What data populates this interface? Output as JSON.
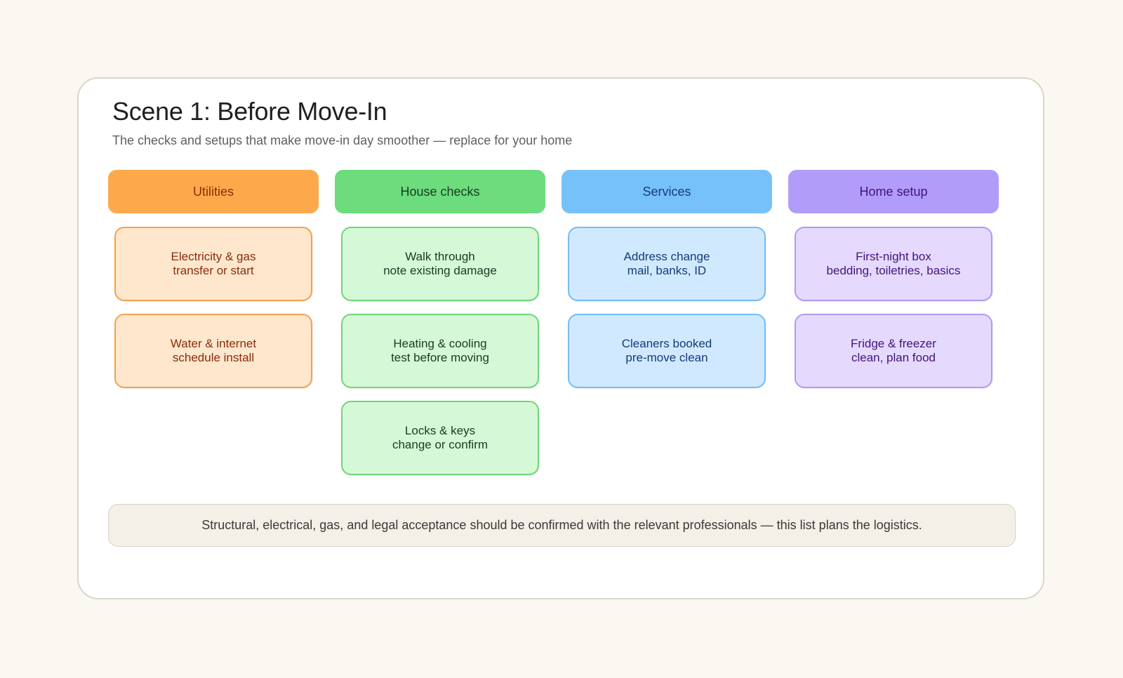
{
  "title": "Scene 1: Before Move-In",
  "subtitle": "The checks and setups that make move-in day smoother — replace for your home",
  "columns": [
    {
      "header": "Utilities",
      "colors": {
        "header_bg": "#fda94b",
        "header_text": "#8a2c0c",
        "card_bg": "#fee7cd",
        "card_border": "#f3a24e",
        "card_text": "#8a2c0c"
      },
      "cards": [
        {
          "line1": "Electricity & gas",
          "line2": "transfer or start"
        },
        {
          "line1": "Water & internet",
          "line2": "schedule install"
        }
      ]
    },
    {
      "header": "House checks",
      "colors": {
        "header_bg": "#6ddc7c",
        "header_text": "#173d22",
        "card_bg": "#d5f8d7",
        "card_border": "#6fd67a",
        "card_text": "#173d22"
      },
      "cards": [
        {
          "line1": "Walk through",
          "line2": "note existing damage"
        },
        {
          "line1": "Heating & cooling",
          "line2": "test before moving"
        },
        {
          "line1": "Locks & keys",
          "line2": "change or confirm"
        }
      ]
    },
    {
      "header": "Services",
      "colors": {
        "header_bg": "#77c1fb",
        "header_text": "#133a7a",
        "card_bg": "#d1e9ff",
        "card_border": "#76bdf1",
        "card_text": "#133a7a"
      },
      "cards": [
        {
          "line1": "Address change",
          "line2": "mail, banks, ID"
        },
        {
          "line1": "Cleaners booked",
          "line2": "pre-move clean"
        }
      ]
    },
    {
      "header": "Home setup",
      "colors": {
        "header_bg": "#b19cfa",
        "header_text": "#42137c",
        "card_bg": "#e5dafd",
        "card_border": "#b09af0",
        "card_text": "#42137c"
      },
      "cards": [
        {
          "line1": "First-night box",
          "line2": "bedding, toiletries, basics"
        },
        {
          "line1": "Fridge & freezer",
          "line2": "clean, plan food"
        }
      ]
    }
  ],
  "note": "Structural, electrical, gas, and legal acceptance should be confirmed with the relevant professionals — this list plans the logistics."
}
